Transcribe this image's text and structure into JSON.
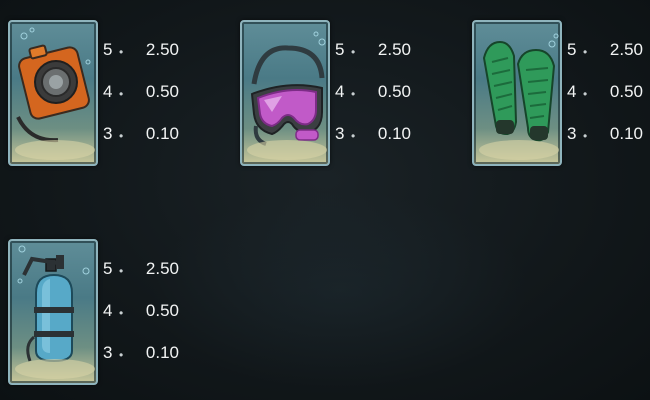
{
  "paytable": {
    "symbols": [
      {
        "icon": "underwater-camera-icon",
        "payouts": [
          {
            "count": "5",
            "value": "2.50"
          },
          {
            "count": "4",
            "value": "0.50"
          },
          {
            "count": "3",
            "value": "0.10"
          }
        ]
      },
      {
        "icon": "diving-mask-icon",
        "payouts": [
          {
            "count": "5",
            "value": "2.50"
          },
          {
            "count": "4",
            "value": "0.50"
          },
          {
            "count": "3",
            "value": "0.10"
          }
        ]
      },
      {
        "icon": "swim-fins-icon",
        "payouts": [
          {
            "count": "5",
            "value": "2.50"
          },
          {
            "count": "4",
            "value": "0.50"
          },
          {
            "count": "3",
            "value": "0.10"
          }
        ]
      },
      {
        "icon": "oxygen-tank-icon",
        "payouts": [
          {
            "count": "5",
            "value": "2.50"
          },
          {
            "count": "4",
            "value": "0.50"
          },
          {
            "count": "3",
            "value": "0.10"
          }
        ]
      }
    ],
    "separator": "•"
  },
  "colors": {
    "background": "#12181b",
    "tile_border": "#8fb4bd",
    "text": "#f2f4f4"
  }
}
